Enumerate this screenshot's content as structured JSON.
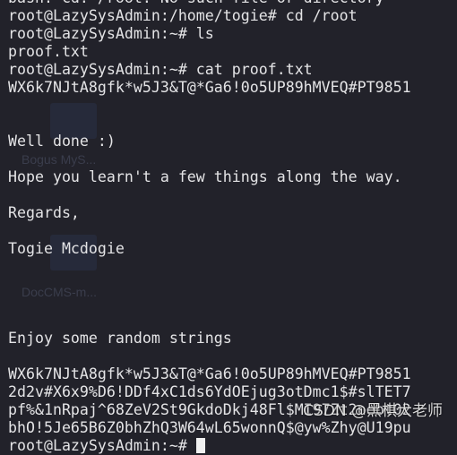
{
  "desktop_icons": [
    "Bogus MyS...",
    "DocCMS-m..."
  ],
  "terminal": {
    "lines": [
      "bash: cd: /root: No such file or directory",
      "root@LazySysAdmin:/home/togie# cd /root",
      "root@LazySysAdmin:~# ls",
      "proof.txt",
      "root@LazySysAdmin:~# cat proof.txt",
      "WX6k7NJtA8gfk*w5J3&T@*Ga6!0o5UP89hMVEQ#PT9851",
      "",
      "",
      "Well done :)",
      "",
      "Hope you learn't a few things along the way.",
      "",
      "Regards,",
      "",
      "Togie Mcdogie",
      "",
      "",
      "",
      "",
      "Enjoy some random strings",
      "",
      "WX6k7NJtA8gfk*w5J3&T@*Ga6!0o5UP89hMVEQ#PT9851",
      "2d2v#X6x9%D6!DDf4xC1ds6YdOEjug3otDmc1$#slTET7",
      "pf%&1nRpaj^68ZeV2St9GkdoDkj48Fl$MI97Zt2nebt02",
      "bhO!5Je65B6Z0bhZhQ3W64wL65wonnQ$@yw%Zhy@U19pu"
    ],
    "prompt": "root@LazySysAdmin:~# "
  },
  "watermark": "CSDN @黑棋大老师"
}
